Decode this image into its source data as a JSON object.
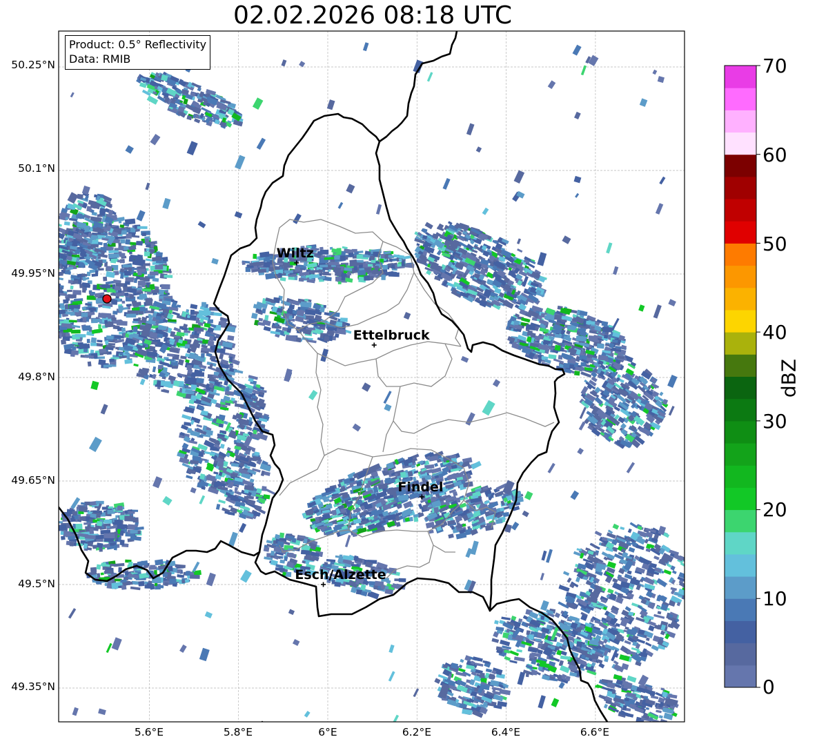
{
  "title": "02.02.2026 08:18 UTC",
  "info": {
    "product": "Product: 0.5° Reflectivity",
    "source": "Data: RMIB"
  },
  "lat_labels": [
    "50.25°N",
    "50.1°N",
    "49.95°N",
    "49.8°N",
    "49.65°N",
    "49.5°N",
    "49.35°N"
  ],
  "lon_labels": [
    "5.6°E",
    "5.8°E",
    "6°E",
    "6.2°E",
    "6.4°E",
    "6.6°E"
  ],
  "cities": [
    {
      "name": "Wiltz",
      "lon": 5.93,
      "lat": 49.966
    },
    {
      "name": "Ettelbruck",
      "lon": 6.104,
      "lat": 49.847
    },
    {
      "name": "Findel",
      "lon": 6.211,
      "lat": 49.627
    },
    {
      "name": "Esch/Alzette",
      "lon": 5.99,
      "lat": 49.5
    }
  ],
  "radar_site": {
    "lon": 5.505,
    "lat": 49.914,
    "color": "#e3101a"
  },
  "colorbar": {
    "label": "dBZ",
    "ticks": [
      "0",
      "10",
      "20",
      "30",
      "40",
      "50",
      "60",
      "70"
    ],
    "colors": [
      "#6576ad",
      "#57699f",
      "#4461a2",
      "#4a79b5",
      "#5c9cc9",
      "#63c0dc",
      "#5fd6c6",
      "#3cd56f",
      "#12c826",
      "#12b71f",
      "#13a31a",
      "#0f8e14",
      "#0c7a12",
      "#0b6510",
      "#46780e",
      "#aab20c",
      "#fdd500",
      "#fbb200",
      "#fc9700",
      "#fe7b00",
      "#e00000",
      "#c00000",
      "#a00000",
      "#7c0000",
      "#ffe1ff",
      "#ffb1ff",
      "#ff6bff",
      "#e93ce6"
    ]
  }
}
